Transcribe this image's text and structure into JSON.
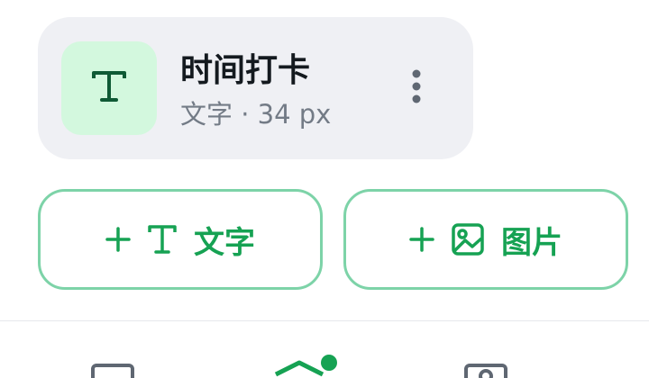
{
  "layer": {
    "title": "时间打卡",
    "subtitle": "文字 · 34 px",
    "thumb_icon": "text-type-icon",
    "menu_icon": "more-vertical-icon"
  },
  "actions": {
    "add_text": {
      "label": "文字",
      "icon": "text-type-icon"
    },
    "add_image": {
      "label": "图片",
      "icon": "image-icon"
    }
  },
  "bottom_nav": {
    "items": [
      {
        "icon": "device-frame-icon"
      },
      {
        "icon": "layers-icon",
        "has_badge": true
      },
      {
        "icon": "image-gallery-icon"
      }
    ]
  },
  "colors": {
    "accent": "#16a253",
    "accent_border": "#7dd3a8",
    "card_bg": "#eff0f4",
    "thumb_bg": "#d3f8de",
    "title": "#141a1f",
    "subtitle": "#737b86",
    "nav_icon": "#5f6772"
  }
}
